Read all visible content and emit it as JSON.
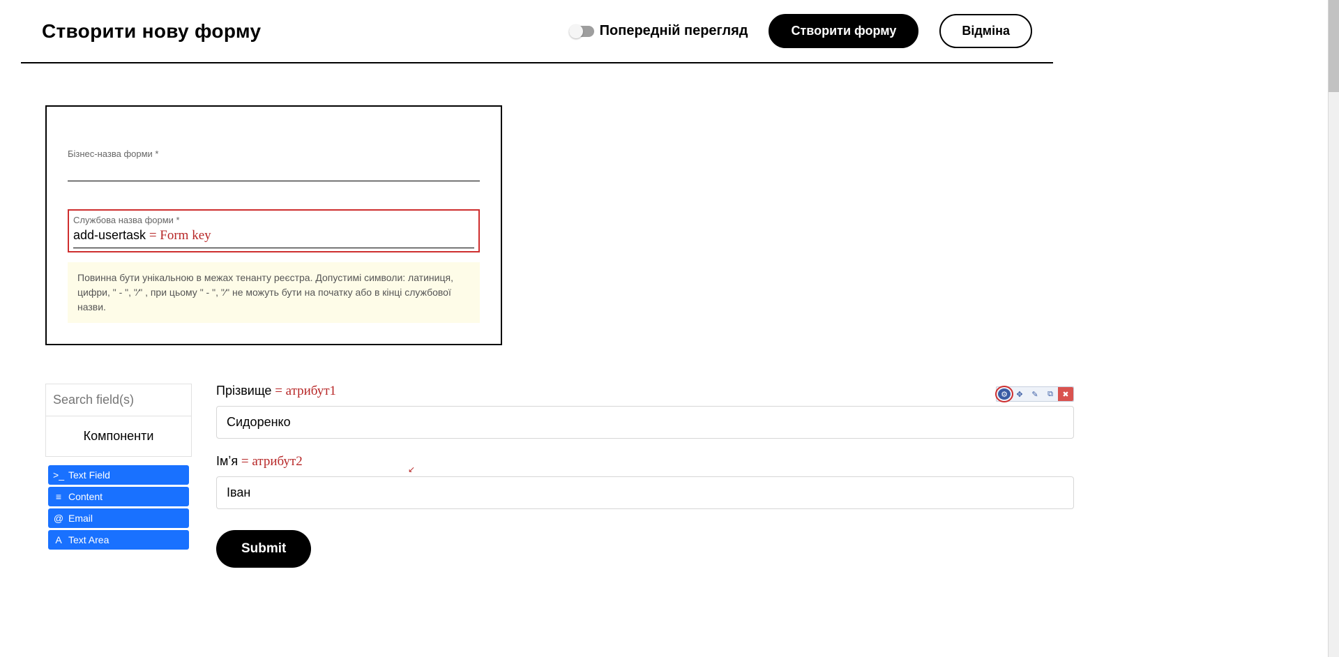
{
  "header": {
    "title": "Створити нову форму",
    "preview_label": "Попередній перегляд",
    "create_label": "Створити форму",
    "cancel_label": "Відміна"
  },
  "metadata": {
    "business_name_label": "Бізнес-назва форми *",
    "service_name_label": "Службова назва форми *",
    "service_value": "add-usertask",
    "formkey_annotation": " = Form key",
    "helper": "Повинна бути унікальною в межах тенанту реєстра. Допустимі символи: латиниця, цифри, \" - \", \"⁄\" , при цьому  \" - \", \"⁄\" не можуть бути на початку або в кінці службової назви."
  },
  "sidebar": {
    "search_placeholder": "Search field(s)",
    "panel_title": "Компоненти",
    "items": [
      {
        "icon": ">_",
        "label": "Text Field"
      },
      {
        "icon": "≡",
        "label": "Content"
      },
      {
        "icon": "@",
        "label": "Email"
      },
      {
        "icon": "A",
        "label": "Text Area"
      }
    ]
  },
  "canvas": {
    "fields": [
      {
        "label": "Прізвище",
        "annot": " = атрибут1",
        "value": "Сидоренко"
      },
      {
        "label": "Імʼя",
        "annot": " = атрибут2",
        "value": "Іван"
      }
    ],
    "submit_label": "Submit"
  },
  "toolbar_icons": {
    "settings": "⚙",
    "move": "✥",
    "edit": "✎",
    "copy": "⧉",
    "delete": "✖"
  }
}
